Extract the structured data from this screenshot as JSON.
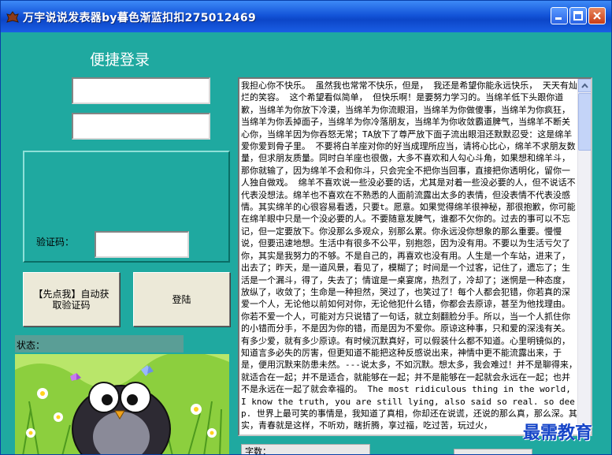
{
  "window": {
    "title": "万宇说说发表器by暮色渐蓝扣扣275012469",
    "colors": {
      "background": "#1fa9a0",
      "titlebar": "#1455d9"
    }
  },
  "login": {
    "heading": "便捷登录",
    "qq_value": "",
    "password_value": "",
    "captcha_label": "验证码：",
    "captcha_value": ""
  },
  "buttons": {
    "auto_captcha": "【先点我】自动获取验证码",
    "login": "登陆"
  },
  "status": {
    "label": "状态："
  },
  "post": {
    "text": "我担心你不快乐。 虽然我也常常不快乐，但是， 我还是希望你能永远快乐， 天天有灿烂的笑容。 这个希望看似简单， 但快乐啊！是要努力学习的。当绵羊低下头跟你道歉，当绵羊为你放下冷漠，当绵羊为你流眼泪，当绵羊为你做傻事，当绵羊为你疯狂，当绵羊为你丢掉面子，当绵羊为你冷落朋友，当绵羊为你收敛霸道脾气，当绵羊不断关心你，当绵羊因为你吞怒无常；TA放下了尊严放下面子流出眼泪还默默忍受：这是绵羊爱你爱到骨子里。 不要将白羊座对你的好当成理所应当，请将心比心，绵羊不求朋友数量，但求朋友质量。同时白羊座也很傲，大多不喜欢和人勾心斗角，如果想和绵羊斗，那你就输了，因为绵羊不会和你斗，只会完全不把你当回事，直接把你透明化，留你一人独自做戏。 绵羊不喜欢说一些没必要的话，尤其是对着一些没必要的人，但不说话不代表没想法。绵羊也不喜欢在不熟悉的人面前流露出太多的表情，但没表情不代表没感情。其实绵羊的心很容易看透，只要t。愿意。如果觉得绵羊很神秘，那很抱歉，你可能在绵羊眼中只是一个没必要的人。不要随意发脾气，谁都不欠你的。过去的事可以不忘记，但一定要放下。你没那么多观众，别那么累。你永远没你想象的那么重要。慢慢说，但要迅速地想。生活中有很多不公平，别抱怨，因为没有用。不要以为生活亏欠了你，其实是我努力的不够。不是自己的，再喜欢也没有用。人生是一个车站，进来了，出去了；昨天，是一道风景，看见了，模糊了；时间是一个过客，记住了，遗忘了；生活是一个漏斗，得了，失去了；情谊是一桌宴席，热烈了，冷却了；迷惘是一种态度，放纵了，收敛了；生命是一种担然，哭过了，也笑过了！每个人都会犯错，你若真的深爱一个人，无论他以前如何对你，无论他犯什么错，你都会去原谅，甚至为他找理由。你若不爱一个人，可能对方只说错了一句话，就立刻翻脸分手。所以，当一个人抓住你的小错而分手，不是因为你的错，而是因为不爱你。原谅这种事，只和爱的深浅有关。有多少爱，就有多少原谅。有时候沉默真好，可以假装什么都不知道。心里明镜似的，知道言多必失的厉害，但更知道不能把这种反感说出来，神情中更不能流露出来，于是，便用沉默来防患未然。---说太多，不如沉默。想太多，我会难过！并不是聊得来，就适合在一起；并不是适合，就能够在一起；并不是能够在一起就会永远在一起；也并不是永远在一起了就会幸福的。 The most ridiculous thing in the world, I know the truth, you are still lying, also said so real. so deep. 世界上最可笑的事情是，我知道了真相，你却还在说谎，还说的那么真，那么深。其实，青春就是这样，不听劝，瞎折腾，享过福，吃过苦，玩过火，"
  },
  "bottom": {
    "label": "字数："
  },
  "watermark": "最需教育"
}
